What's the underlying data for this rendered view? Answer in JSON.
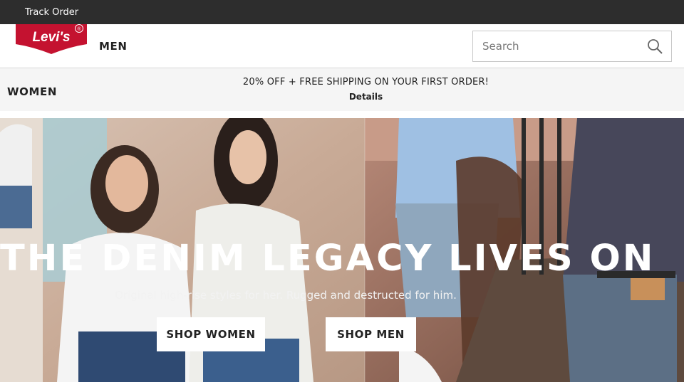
{
  "topbar": {
    "track_order": "Track Order"
  },
  "header": {
    "logo_text": "Levi's",
    "logo_mark": "®",
    "nav_men": "MEN",
    "search_placeholder": "Search",
    "search_icon": "search-icon"
  },
  "subbar": {
    "nav_women": "WOMEN",
    "promo": "20% OFF + FREE SHIPPING ON YOUR FIRST ORDER!",
    "details": "Details"
  },
  "hero": {
    "headline": "THE DENIM LEGACY LIVES ON",
    "subline": "Original high-rise styles for her. Rugged and destructed for him.",
    "shop_women": "SHOP WOMEN",
    "shop_men": "SHOP MEN"
  },
  "colors": {
    "topbar": "#2d2d2d",
    "brand_red": "#c41230",
    "subbar": "#f5f5f5"
  }
}
